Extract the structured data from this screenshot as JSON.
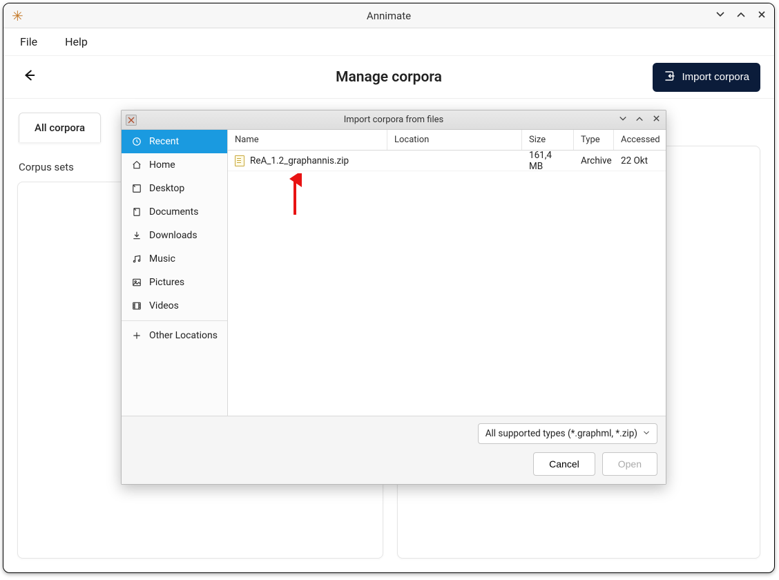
{
  "window": {
    "title": "Annimate"
  },
  "menubar": {
    "file": "File",
    "help": "Help"
  },
  "page": {
    "title": "Manage corpora",
    "import_button": "Import corpora"
  },
  "tabs": {
    "all_corpora": "All corpora"
  },
  "section": {
    "corpus_sets": "Corpus sets"
  },
  "dialog": {
    "title": "Import corpora from files",
    "sidebar": {
      "recent": "Recent",
      "home": "Home",
      "desktop": "Desktop",
      "documents": "Documents",
      "downloads": "Downloads",
      "music": "Music",
      "pictures": "Pictures",
      "videos": "Videos",
      "other": "Other Locations"
    },
    "columns": {
      "name": "Name",
      "location": "Location",
      "size": "Size",
      "type": "Type",
      "accessed": "Accessed"
    },
    "files": [
      {
        "name": "ReA_1.2_graphannis.zip",
        "location": "",
        "size": "161,4 MB",
        "type": "Archive",
        "accessed": "22 Okt"
      }
    ],
    "filter": "All supported types (*.graphml, *.zip)",
    "buttons": {
      "cancel": "Cancel",
      "open": "Open"
    }
  }
}
